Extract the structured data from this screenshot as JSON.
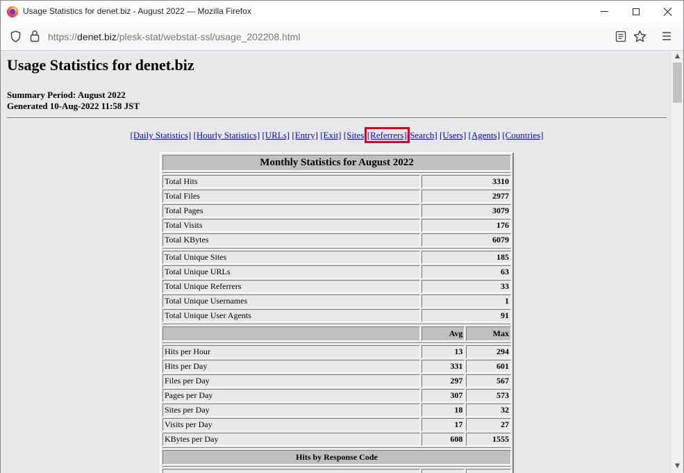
{
  "window": {
    "title": "Usage Statistics for denet.biz - August 2022 — Mozilla Firefox"
  },
  "address_bar": {
    "scheme": "https://",
    "host": "denet.biz",
    "path": "/plesk-stat/webstat-ssl/usage_202208.html"
  },
  "page": {
    "title": "Usage Statistics for denet.biz",
    "summary_period": "Summary Period: August 2022",
    "generated": "Generated 10-Aug-2022 11:58 JST",
    "nav_links": [
      "[Daily Statistics]",
      "[Hourly Statistics]",
      "[URLs]",
      "[Entry]",
      "[Exit]",
      "[Sites]",
      "[Referrers]",
      "[Search]",
      "[Users]",
      "[Agents]",
      "[Countries]"
    ],
    "highlighted_link": "[Referrers]"
  },
  "monthly": {
    "title": "Monthly Statistics for August 2022",
    "totals": [
      {
        "label": "Total Hits",
        "value": "3310"
      },
      {
        "label": "Total Files",
        "value": "2977"
      },
      {
        "label": "Total Pages",
        "value": "3079"
      },
      {
        "label": "Total Visits",
        "value": "176"
      },
      {
        "label": "Total KBytes",
        "value": "6079"
      }
    ],
    "uniques": [
      {
        "label": "Total Unique Sites",
        "value": "185"
      },
      {
        "label": "Total Unique URLs",
        "value": "63"
      },
      {
        "label": "Total Unique Referrers",
        "value": "33"
      },
      {
        "label": "Total Unique Usernames",
        "value": "1"
      },
      {
        "label": "Total Unique User Agents",
        "value": "91"
      }
    ],
    "avg_header": "Avg",
    "max_header": "Max",
    "rates": [
      {
        "label": "Hits per Hour",
        "avg": "13",
        "max": "294"
      },
      {
        "label": "Hits per Day",
        "avg": "331",
        "max": "601"
      },
      {
        "label": "Files per Day",
        "avg": "297",
        "max": "567"
      },
      {
        "label": "Pages per Day",
        "avg": "307",
        "max": "573"
      },
      {
        "label": "Sites per Day",
        "avg": "18",
        "max": "32"
      },
      {
        "label": "Visits per Day",
        "avg": "17",
        "max": "27"
      },
      {
        "label": "KBytes per Day",
        "avg": "608",
        "max": "1555"
      }
    ],
    "response_code_header": "Hits by Response Code"
  }
}
